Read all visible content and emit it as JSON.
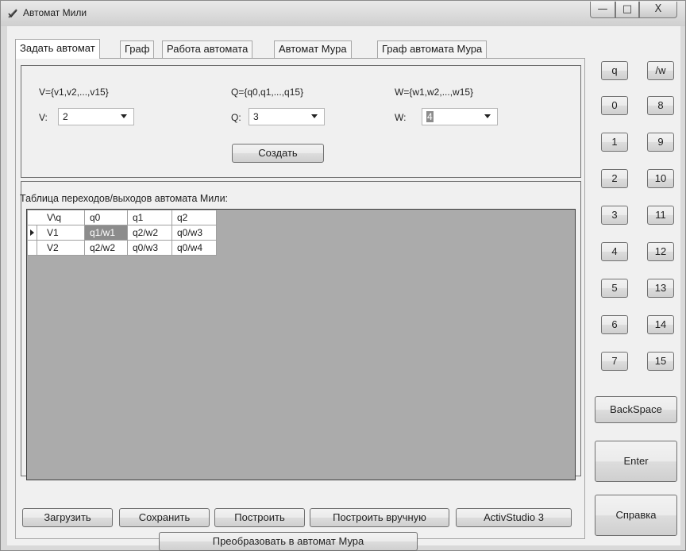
{
  "window": {
    "title": "Автомат Мили"
  },
  "tabs": [
    {
      "label": "Задать автомат",
      "active": true
    },
    {
      "label": "Граф",
      "active": false
    },
    {
      "label": "Работа автомата",
      "active": false
    },
    {
      "label": "Автомат Мура",
      "active": false
    },
    {
      "label": "Граф автомата Мура",
      "active": false
    }
  ],
  "sets": {
    "v_label": "V={v1,v2,...,v15}",
    "q_label": "Q={q0,q1,...,q15}",
    "w_label": "W={w1,w2,...,w15}"
  },
  "combos": {
    "v": {
      "caption": "V:",
      "value": "2"
    },
    "q": {
      "caption": "Q:",
      "value": "3"
    },
    "w": {
      "caption": "W:",
      "value": "4"
    }
  },
  "create_button": "Создать",
  "table_title": "Таблица переходов/выходов автомата Мили:",
  "grid": {
    "headers": [
      "V\\q",
      "q0",
      "q1",
      "q2"
    ],
    "rows": [
      {
        "name": "V1",
        "cells": [
          "q1/w1",
          "q2/w2",
          "q0/w3"
        ]
      },
      {
        "name": "V2",
        "cells": [
          "q2/w2",
          "q0/w3",
          "q0/w4"
        ]
      }
    ]
  },
  "bottom_buttons": {
    "load": "Загрузить",
    "save": "Сохранить",
    "build": "Построить",
    "build_manual": "Построить вручную",
    "activstudio": "ActivStudio 3",
    "convert": "Преобразовать в автомат Мура"
  },
  "side_buttons": {
    "q": "q",
    "w": "/w",
    "n0": "0",
    "n1": "1",
    "n2": "2",
    "n3": "3",
    "n4": "4",
    "n5": "5",
    "n6": "6",
    "n7": "7",
    "n8": "8",
    "n9": "9",
    "n10": "10",
    "n11": "11",
    "n12": "12",
    "n13": "13",
    "n14": "14",
    "n15": "15",
    "backspace": "BackSpace",
    "enter": "Enter",
    "help": "Справка"
  }
}
